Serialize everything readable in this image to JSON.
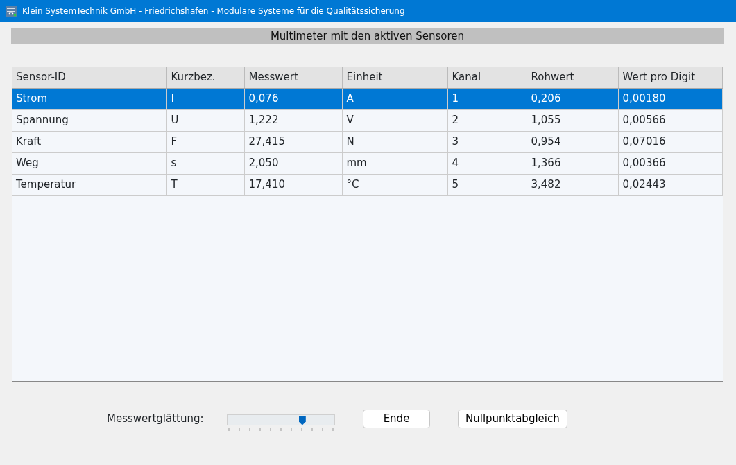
{
  "window": {
    "title": "Klein SystemTechnik GmbH - Friedrichshafen - Modulare Systeme für die Qualitätssicherung"
  },
  "heading": "Multimeter mit den aktiven Sensoren",
  "table": {
    "columns": [
      "Sensor-ID",
      "Kurzbez.",
      "Messwert",
      "Einheit",
      "Kanal",
      "Rohwert",
      "Wert pro Digit"
    ],
    "rows": [
      {
        "selected": true,
        "cells": [
          "Strom",
          "I",
          "0,076",
          "A",
          "1",
          "0,206",
          "0,00180"
        ]
      },
      {
        "selected": false,
        "cells": [
          "Spannung",
          "U",
          "1,222",
          "V",
          "2",
          "1,055",
          "0,00566"
        ]
      },
      {
        "selected": false,
        "cells": [
          "Kraft",
          "F",
          "27,415",
          "N",
          "3",
          "0,954",
          "0,07016"
        ]
      },
      {
        "selected": false,
        "cells": [
          "Weg",
          "s",
          "2,050",
          "mm",
          "4",
          "1,366",
          "0,00366"
        ]
      },
      {
        "selected": false,
        "cells": [
          "Temperatur",
          "T",
          "17,410",
          "°C",
          "5",
          "3,482",
          "0,02443"
        ]
      }
    ]
  },
  "smoothing": {
    "label": "Messwertglättung:",
    "level": 0.7
  },
  "buttons": [
    "Ende",
    "Nullpunktabgleich"
  ]
}
